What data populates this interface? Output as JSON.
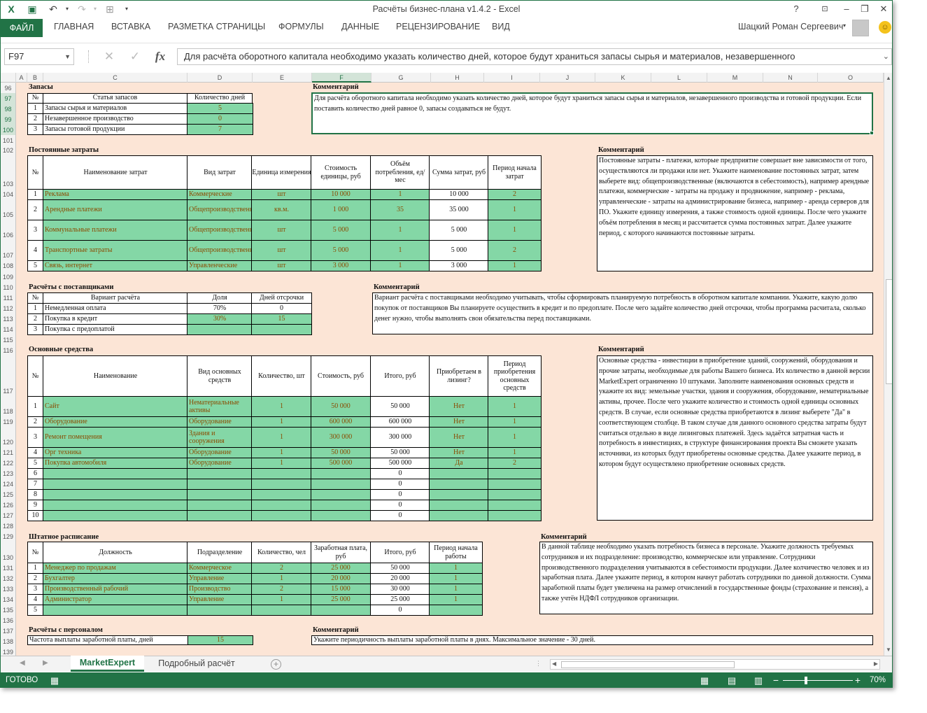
{
  "window": {
    "title": "Расчёты бизнес-плана v1.4.2 - Excel",
    "help": "?",
    "minimize": "–",
    "restore": "❐",
    "close": "✕"
  },
  "ribbon": {
    "tabs": [
      "ФАЙЛ",
      "ГЛАВНАЯ",
      "ВСТАВКА",
      "РАЗМЕТКА СТРАНИЦЫ",
      "ФОРМУЛЫ",
      "ДАННЫЕ",
      "РЕЦЕНЗИРОВАНИЕ",
      "ВИД"
    ],
    "user": "Шацкий Роман Сергеевич"
  },
  "formula_bar": {
    "name_box": "F97",
    "fx": "fx",
    "formula": "Для расчёта оборотного капитала необходимо указать количество дней, которое будут храниться запасы сырья и материалов, незавершенного"
  },
  "columns": [
    "A",
    "B",
    "C",
    "D",
    "E",
    "F",
    "G",
    "H",
    "I",
    "J",
    "K",
    "L",
    "M",
    "N",
    "O"
  ],
  "rows": [
    "96",
    "97",
    "98",
    "99",
    "100",
    "101",
    "102",
    "103",
    "104",
    "105",
    "106",
    "107",
    "108",
    "109",
    "110",
    "111",
    "112",
    "113",
    "114",
    "115",
    "116",
    "117",
    "118",
    "119",
    "120",
    "121",
    "122",
    "123",
    "124",
    "125",
    "126",
    "127",
    "128",
    "129",
    "130",
    "131",
    "132",
    "133",
    "134",
    "135",
    "136",
    "137",
    "138",
    "139"
  ],
  "zapasy": {
    "title": "Запасы",
    "h_item": "Статья запасов",
    "h_days": "Количество дней",
    "rows": [
      {
        "n": "1",
        "name": "Запасы сырья и материалов",
        "days": "5"
      },
      {
        "n": "2",
        "name": "Незавершенное производство",
        "days": "0"
      },
      {
        "n": "3",
        "name": "Запасы готовой продукции",
        "days": "7"
      }
    ],
    "comment_title": "Комментарий",
    "comment": "Для расчёта оборотного капитала необходимо указать количество дней, которое будут храниться запасы сырья и материалов, незавершенного производства и готовой продукции. Если поставить количество дней равное 0, запасы создаваться не будут."
  },
  "fixed": {
    "title": "Постоянные затраты",
    "headers": [
      "№",
      "Наименование затрат",
      "Вид затрат",
      "Единица измерения",
      "Стоимость единицы, руб",
      "Объём потребления, ед/мес",
      "Сумма затрат, руб",
      "Период начала затрат"
    ],
    "rows": [
      {
        "n": "1",
        "name": "Реклама",
        "type": "Коммерческие",
        "unit": "шт",
        "cost": "10 000",
        "qty": "1",
        "sum": "10 000",
        "start": "2"
      },
      {
        "n": "2",
        "name": "Арендные платежи",
        "type": "Общепроизводственные",
        "unit": "кв.м.",
        "cost": "1 000",
        "qty": "35",
        "sum": "35 000",
        "start": "1"
      },
      {
        "n": "3",
        "name": "Коммунальные платежи",
        "type": "Общепроизводственные",
        "unit": "шт",
        "cost": "5 000",
        "qty": "1",
        "sum": "5 000",
        "start": "1"
      },
      {
        "n": "4",
        "name": "Транспортные затраты",
        "type": "Общепроизводственные",
        "unit": "шт",
        "cost": "5 000",
        "qty": "1",
        "sum": "5 000",
        "start": "2"
      },
      {
        "n": "5",
        "name": "Связь, интернет",
        "type": "Управленческие",
        "unit": "шт",
        "cost": "3 000",
        "qty": "1",
        "sum": "3 000",
        "start": "1"
      }
    ],
    "comment_title": "Комментарий",
    "comment": "Постоянные затраты - платежи, которые предприятие совершает вне зависимости от того, осуществляются ли продажи или нет. Укажите наименование постоянных затрат, затем выберете вид: общепроизводственные (включаются в себестоимость), например арендные платежи, коммерческие - затраты на продажу и продвижение, например - реклама, управленческие - затраты на администрирование бизнеса, например - аренда серверов для ПО. Укажите единицу измерения, а также стоимость одной единицы. После чего укажите объём потребления в месяц и рассчитается сумма постоянных затрат. Далее укажите период, с которого начинаются постоянные затраты."
  },
  "suppliers": {
    "title": "Расчёты с поставщиками",
    "headers": [
      "№",
      "Вариант расчёта",
      "Доля",
      "Дней отсрочки"
    ],
    "rows": [
      {
        "n": "1",
        "name": "Немедленная оплата",
        "share": "70%",
        "days": "0"
      },
      {
        "n": "2",
        "name": "Покупка в кредит",
        "share": "30%",
        "days": "15"
      },
      {
        "n": "3",
        "name": "Покупка с предоплатой",
        "share": "",
        "days": ""
      }
    ],
    "comment_title": "Комментарий",
    "comment": "Вариант расчёта с поставщиками необходимо учитывать, чтобы сформировать планируемую потребность в оборотном капитале компании. Укажите, какую долю покупок от поставщиков Вы планируете осуществить в кредит и по предоплате. После чего задайте количество дней отсрочки, чтобы программа расчитала, сколько денег нужно, чтобы выполнять свои обязательства перед поставщиками."
  },
  "assets": {
    "title": "Основные средства",
    "headers": [
      "№",
      "Наименование",
      "Вид основных средств",
      "Количество, шт",
      "Стоимость, руб",
      "Итого, руб",
      "Приобретаем в лизинг?",
      "Период приобретения основных средств"
    ],
    "rows": [
      {
        "n": "1",
        "name": "Сайт",
        "type": "Нематериальные активы",
        "qty": "1",
        "cost": "50 000",
        "total": "50 000",
        "lease": "Нет",
        "period": "1"
      },
      {
        "n": "2",
        "name": "Оборудование",
        "type": "Оборудование",
        "qty": "1",
        "cost": "600 000",
        "total": "600 000",
        "lease": "Нет",
        "period": "1"
      },
      {
        "n": "3",
        "name": "Ремонт помещения",
        "type": "Здания и сооружения",
        "qty": "1",
        "cost": "300 000",
        "total": "300 000",
        "lease": "Нет",
        "period": "1"
      },
      {
        "n": "4",
        "name": "Орг техника",
        "type": "Оборудование",
        "qty": "1",
        "cost": "50 000",
        "total": "50 000",
        "lease": "Нет",
        "period": "1"
      },
      {
        "n": "5",
        "name": "Покупка автомобиля",
        "type": "Оборудование",
        "qty": "1",
        "cost": "500 000",
        "total": "500 000",
        "lease": "Да",
        "period": "2"
      },
      {
        "n": "6",
        "name": "",
        "type": "",
        "qty": "",
        "cost": "",
        "total": "0",
        "lease": "",
        "period": ""
      },
      {
        "n": "7",
        "name": "",
        "type": "",
        "qty": "",
        "cost": "",
        "total": "0",
        "lease": "",
        "period": ""
      },
      {
        "n": "8",
        "name": "",
        "type": "",
        "qty": "",
        "cost": "",
        "total": "0",
        "lease": "",
        "period": ""
      },
      {
        "n": "9",
        "name": "",
        "type": "",
        "qty": "",
        "cost": "",
        "total": "0",
        "lease": "",
        "period": ""
      },
      {
        "n": "10",
        "name": "",
        "type": "",
        "qty": "",
        "cost": "",
        "total": "0",
        "lease": "",
        "period": ""
      }
    ],
    "comment_title": "Комментарий",
    "comment": "Основные средства - инвестиции в приобретение зданий, сооружений, оборудования и прочие затраты, необходимые для работы Вашего бизнеса. Их количество в данной версии MarketExpert ограниченно 10 штуками. Заполните наименования основных средств и укажите их вид: земельные участки, здания и сооружения, оборудование, нематериальные активы, прочее. После чего укажите количество и стоимость одной единицы основных средств. В случае, если основные средства приобретаются в лизинг выберете \"Да\" в соответствующем столбце. В таком случае для данного основного средства затраты будут считаться отдельно в виде лизинговых платежей. Здесь задаётся затратная часть и потребность в инвестициях, в структуре финансирования проекта Вы сможете указать источники, из которых будут приобретены основные средства. Далее укажите период, в котором будут осуществлено приобретение основных средств."
  },
  "staff": {
    "title": "Штатное расписание",
    "headers": [
      "№",
      "Должность",
      "Подразделение",
      "Количество, чел",
      "Заработная плата, руб",
      "Итого, руб",
      "Период начала работы"
    ],
    "rows": [
      {
        "n": "1",
        "pos": "Менеджер по продажам",
        "dept": "Коммерческое",
        "qty": "2",
        "salary": "25 000",
        "total": "50 000",
        "start": "1"
      },
      {
        "n": "2",
        "pos": "Бухгалтер",
        "dept": "Управление",
        "qty": "1",
        "salary": "20 000",
        "total": "20 000",
        "start": "1"
      },
      {
        "n": "3",
        "pos": "Производственный рабочий",
        "dept": "Производство",
        "qty": "2",
        "salary": "15 000",
        "total": "30 000",
        "start": "1"
      },
      {
        "n": "4",
        "pos": "Администратор",
        "dept": "Управление",
        "qty": "1",
        "salary": "25 000",
        "total": "25 000",
        "start": "1"
      },
      {
        "n": "5",
        "pos": "",
        "dept": "",
        "qty": "",
        "salary": "",
        "total": "0",
        "start": ""
      }
    ],
    "comment_title": "Комментарий",
    "comment": "В данной таблице необходимо указать потребность бизнеса в персонале. Укажите должность требуемых сотрудников и их подразделение: производство, коммерческое или управление. Сотрудники производственного подразделения учитываются в себестоимости продукции. Далее колчичество человек и из заработная плата. Далее укажите период, в котором начнут работать сотрудники по данной должности. Сумма заработной платы будет увеличена на размер отчислений в государственные фонды (страхование и пенсия), а также учтён НДФЛ сотрудников организации."
  },
  "personnel": {
    "title": "Расчёты с персоналом",
    "label": "Частота выплаты заработной платы, дней",
    "value": "15",
    "comment_title": "Комментарий",
    "comment": "Укажите периодичность выплаты заработной платы в днях. Максимальное значение - 30 дней."
  },
  "sheets": {
    "active": "MarketExpert",
    "other": "Подробный расчёт",
    "add": "+"
  },
  "status": {
    "ready": "ГОТОВО",
    "zoom": "70%"
  }
}
